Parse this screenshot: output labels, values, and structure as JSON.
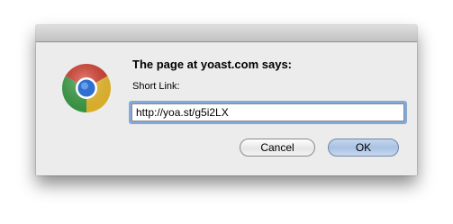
{
  "dialog": {
    "heading": "The page at yoast.com says:",
    "prompt_label": "Short Link:",
    "input_value": "http://yoa.st/g5i2LX",
    "cancel_label": "Cancel",
    "ok_label": "OK",
    "app_icon": "chrome-logo-icon"
  },
  "colors": {
    "dialog_bg": "#ececec",
    "focus_ring": "#84a9d8",
    "default_button": "#a9c2e4"
  }
}
